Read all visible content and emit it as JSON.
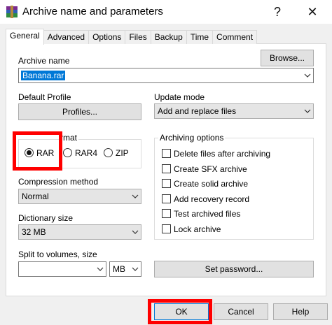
{
  "window": {
    "title": "Archive name and parameters",
    "help_label": "?",
    "close_label": "✕"
  },
  "tabs": [
    "General",
    "Advanced",
    "Options",
    "Files",
    "Backup",
    "Time",
    "Comment"
  ],
  "archive_name": {
    "label": "Archive name",
    "value": "Banana.rar",
    "browse_label": "Browse..."
  },
  "default_profile": {
    "label": "Default Profile",
    "button_label": "Profiles..."
  },
  "update_mode": {
    "label": "Update mode",
    "value": "Add and replace files"
  },
  "archive_format": {
    "label_visible": "rmat",
    "options": [
      {
        "label": "RAR",
        "selected": true
      },
      {
        "label": "RAR4",
        "selected": false
      },
      {
        "label": "ZIP",
        "selected": false
      }
    ]
  },
  "compression": {
    "label": "Compression method",
    "value": "Normal"
  },
  "dictionary": {
    "label": "Dictionary size",
    "value": "32 MB"
  },
  "split": {
    "label": "Split to volumes, size",
    "value": "",
    "unit": "MB"
  },
  "archiving_options": {
    "label": "Archiving options",
    "items": [
      {
        "label": "Delete files after archiving",
        "checked": false
      },
      {
        "label": "Create SFX archive",
        "checked": false
      },
      {
        "label": "Create solid archive",
        "checked": false
      },
      {
        "label": "Add recovery record",
        "checked": false
      },
      {
        "label": "Test archived files",
        "checked": false
      },
      {
        "label": "Lock archive",
        "checked": false
      }
    ]
  },
  "set_password_label": "Set password...",
  "footer": {
    "ok_label": "OK",
    "cancel_label": "Cancel",
    "help_label": "Help"
  },
  "colors": {
    "highlight": "#ff0000",
    "selection": "#0078d7"
  }
}
